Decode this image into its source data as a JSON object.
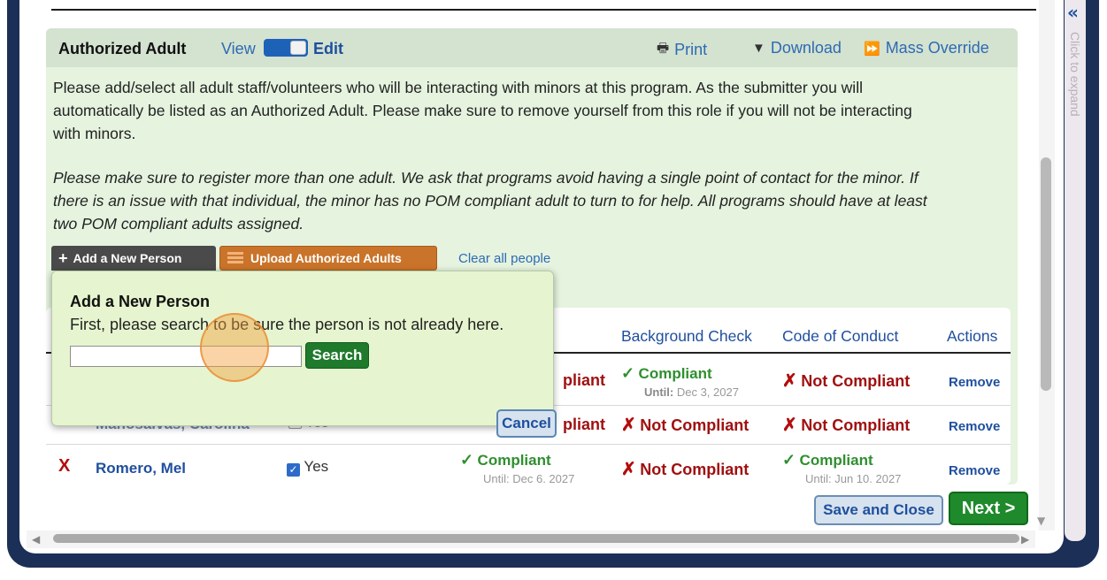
{
  "section": {
    "title": "Authorized Adult",
    "view_label": "View",
    "edit_label": "Edit",
    "actions": {
      "print": "Print",
      "download": "Download",
      "mass_override": "Mass Override"
    }
  },
  "description": {
    "p1_line1": "Please add/select all adult staff/volunteers who will be interacting with minors at this program. As the submitter you will",
    "p1_line2": "automatically be listed as an Authorized Adult. Please make sure to remove yourself from this role if you will not be interacting",
    "p1_line3": "with minors.",
    "p2_line1": "Please make sure to register more than one adult.  We ask that programs avoid having a single point of contact for the minor. If",
    "p2_line2": "there is an issue with that individual, the minor has no POM compliant adult to turn to for help. All programs should have at least",
    "p2_line3": "two POM compliant adults assigned."
  },
  "buttons": {
    "add_person": "Add a New Person",
    "upload_adults": "Upload Authorized Adults",
    "clear_all": "Clear all people",
    "save_close": "Save and Close",
    "next": "Next >"
  },
  "table": {
    "headers": {
      "background_check": "Background Check",
      "code_of_conduct": "Code of Conduct",
      "actions": "Actions"
    },
    "rows": [
      {
        "training_partial": "pliant",
        "background": "Compliant",
        "background_until_label": "Until:",
        "background_until": "Dec 3, 2027",
        "conduct": "Not Compliant",
        "action": "Remove"
      },
      {
        "name_partial": "Manosalvas, Carolina",
        "flag": "Yes",
        "training_partial": "pliant",
        "background": "Not Compliant",
        "conduct": "Not Compliant",
        "action": "Remove"
      },
      {
        "status": "X",
        "name": "Romero, Mel",
        "flag": "Yes",
        "training": "Compliant",
        "training_until_partial": "Until: Dec 6, 2027",
        "background": "Not Compliant",
        "conduct": "Compliant",
        "conduct_until_partial": "Until: Jun 10, 2027",
        "action": "Remove"
      }
    ]
  },
  "popup": {
    "title": "Add a New Person",
    "text": "First, please search to be sure the person is not already here.",
    "search_value": "",
    "search_button": "Search",
    "cancel_button": "Cancel"
  },
  "rail": {
    "text": "Click to expand",
    "chevron": "«"
  },
  "colors": {
    "panel_bg": "#e5f3df",
    "popup_bg": "#e6f5cf",
    "link_blue": "#1f4f9e",
    "compliant_green": "#2f8f2f",
    "noncompliant_red": "#a01010",
    "next_green": "#1f8a2c",
    "upload_orange": "#c9742a"
  }
}
